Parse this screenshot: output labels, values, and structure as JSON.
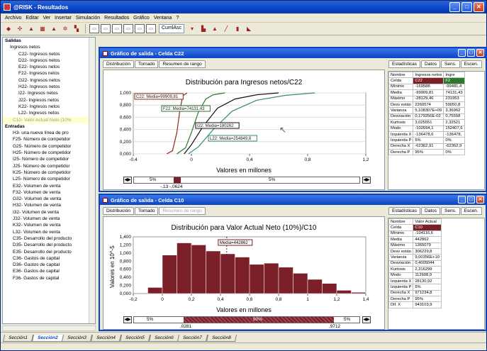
{
  "app": {
    "title": "@RISK - Resultados"
  },
  "menu": [
    "Archivo",
    "Editar",
    "Ver",
    "Insertar",
    "Simulación",
    "Resultados",
    "Gráfico",
    "Ventana",
    "?"
  ],
  "toolbar": {
    "select_value": "CumlAsc"
  },
  "tree": {
    "outputs_header": "Salidas",
    "outputs_group": "Ingresos netos",
    "outputs": [
      "C22- Ingresos netos",
      "D22- Ingresos netos",
      "E22- Ingresos netos",
      "F22- Ingresos netos",
      "G22- Ingresos netos",
      "H22- Ingresos netos",
      "I22- Ingresos netos",
      "J22- Ingresos netos",
      "K22- Ingresos netos",
      "L22- Ingresos netos"
    ],
    "outputs_selected": "C10- Valor Actual Neto (10%",
    "inputs_header": "Entradas",
    "inputs": [
      "H3- una nueva línea de pro",
      "F25- Número de competidor",
      "G25- Número de competidor",
      "H25- Número de competidor",
      "I25- Número de competidor",
      "J25- Número de competidor",
      "K25- Número de competidor",
      "L25- Número de competidor",
      "E32- Volumen de venta",
      "F32- Volumen de venta",
      "G32- Volumen de venta",
      "H32- Volumen de venta",
      "I32- Volumen de venta",
      "J32- Volumen de venta",
      "K32- Volumen de venta",
      "L32- Volumen de venta",
      "C35- Desarrollo del producto",
      "D35- Desarrollo del producto",
      "E35- Desarrollo del producto",
      "C36- Gastos de capital",
      "D36- Gastos de capital",
      "E36- Gastos de capital",
      "F36- Gastos de capital"
    ]
  },
  "win1": {
    "title": "Gráfico de salida - Celda C22",
    "tabs": [
      "Distribución",
      "Tornado",
      "Resumen de rango"
    ],
    "right_tabs": [
      "Estadísticas",
      "Datos",
      "Sens.",
      "Escen."
    ],
    "chart_title": "Distribución para Ingresos netos/C22",
    "xlabel": "Valores en millones",
    "yticks": [
      "1,000",
      "0,800",
      "0,600",
      "0,400",
      "0,200",
      "0,000"
    ],
    "xticks": [
      "-0,4",
      "0",
      "0,4",
      "0,8",
      "1,2"
    ],
    "labels": [
      "C22: Media=99909,81",
      "F22: Media=74131,43",
      "I22: Media=180262",
      "L22: Media=254849,8"
    ],
    "range_left": "5%",
    "range_mid": "90%",
    "range_right": "5%",
    "range_vals": [
      "-,13",
      "-,0624"
    ],
    "stats_header": [
      "Nombre",
      "Ingresos netos",
      "Ingre"
    ],
    "stats_cell": [
      "Celda",
      "C22",
      "F2"
    ],
    "stats_rows": [
      [
        "Mínimo",
        "-169588",
        "-99481,4"
      ],
      [
        "Media",
        "-99909,81",
        "74131,43"
      ],
      [
        "Máximo",
        "-28129,46",
        "231953"
      ],
      [
        "Desv están",
        "2260574",
        "59050,8"
      ],
      [
        "Varianza",
        "5,108307E+09",
        "3,36962"
      ],
      [
        "Desviación",
        "0,179256E-02",
        "0,75558"
      ],
      [
        "Kurtosis",
        "3,025551",
        "2,32521"
      ],
      [
        "Modo",
        "-102694,1",
        "152407,6"
      ],
      [
        "Izquierda X",
        "-136478,6",
        "-136478,"
      ],
      [
        "Izquierda P",
        "5%",
        "0%"
      ],
      [
        "Derecha X",
        "-62362,91",
        "-62362,9"
      ],
      [
        "Derecha P",
        "95%",
        "0%"
      ]
    ]
  },
  "win2": {
    "title": "Gráfico de salida - Celda C10",
    "tabs": [
      "Distribución",
      "Tornado",
      "Resumen de rango"
    ],
    "right_tabs": [
      "Estadísticas",
      "Datos",
      "Sens.",
      "Escen."
    ],
    "chart_title": "Distribución para Valor Actual Neto (10%)/C10",
    "xlabel": "Valores en millones",
    "ylabel": "Valores en",
    "ylabel2": "10^-5",
    "yticks": [
      "1,400",
      "1,200",
      "1,000",
      "0,800",
      "0,600",
      "0,400",
      "0,200",
      "0,000"
    ],
    "xticks": [
      "-0,2",
      "0",
      "0,2",
      "0,4",
      "0,6",
      "0,8",
      "1",
      "1,2",
      "1,4"
    ],
    "mean_label": "Media=442862",
    "range_left": "5%",
    "range_mid": "90%",
    "range_right": "5%",
    "range_vals": [
      ",0281",
      ",9712"
    ],
    "stats_header": [
      "Nombre",
      "Valor Actual"
    ],
    "stats_cell": [
      "Celda",
      "C10"
    ],
    "stats_rows": [
      [
        "Mínimo",
        "-104116,6"
      ],
      [
        "Media",
        "442862"
      ],
      [
        "Máximo",
        "1365079"
      ],
      [
        "Desv están",
        "306229,8"
      ],
      [
        "Varianza",
        "9,00356E+10"
      ],
      [
        "Desviación",
        "0,4005044"
      ],
      [
        "Kurtosis",
        "2,316299"
      ],
      [
        "Modo",
        "112608,9"
      ],
      [
        "Izquierda X",
        "28130,92"
      ],
      [
        "Izquierda P",
        "5%"
      ],
      [
        "Derecha X",
        "971234,8"
      ],
      [
        "Derecha P",
        "95%"
      ],
      [
        "Dif. X",
        "943103,9"
      ]
    ]
  },
  "chart_data": [
    {
      "type": "line",
      "title": "Distribución para Ingresos netos/C22",
      "xlabel": "Valores en millones",
      "ylabel": "",
      "ylim": [
        0,
        1
      ],
      "xlim": [
        -0.4,
        1.2
      ],
      "series": [
        {
          "name": "C22",
          "x": [
            -0.17,
            -0.13,
            -0.1,
            -0.08,
            -0.06,
            -0.03
          ],
          "y": [
            0,
            0.05,
            0.35,
            0.7,
            0.95,
            1
          ]
        },
        {
          "name": "F22",
          "x": [
            -0.1,
            -0.04,
            0.0,
            0.05,
            0.1,
            0.15,
            0.23
          ],
          "y": [
            0,
            0.1,
            0.35,
            0.7,
            0.9,
            0.97,
            1
          ]
        },
        {
          "name": "I22",
          "x": [
            -0.05,
            0.0,
            0.08,
            0.18,
            0.3,
            0.45,
            0.6
          ],
          "y": [
            0,
            0.15,
            0.45,
            0.75,
            0.9,
            0.97,
            1
          ]
        },
        {
          "name": "L22",
          "x": [
            -0.02,
            0.05,
            0.15,
            0.28,
            0.45,
            0.65,
            0.85
          ],
          "y": [
            0,
            0.12,
            0.4,
            0.7,
            0.88,
            0.96,
            1
          ]
        }
      ]
    },
    {
      "type": "bar",
      "title": "Distribución para Valor Actual Neto (10%)/C10",
      "xlabel": "Valores en millones",
      "ylabel": "Valores en 10^-5",
      "ylim": [
        0,
        1.4
      ],
      "x": [
        -0.1,
        0.0,
        0.1,
        0.2,
        0.3,
        0.4,
        0.5,
        0.6,
        0.7,
        0.8,
        0.9,
        1.0,
        1.1,
        1.2,
        1.3
      ],
      "values": [
        0.15,
        0.95,
        1.25,
        1.2,
        1.05,
        0.98,
        0.9,
        0.72,
        0.75,
        0.65,
        0.5,
        0.35,
        0.25,
        0.08,
        0.03
      ]
    }
  ],
  "sheets": [
    "Sección1",
    "Sección2",
    "Sección3",
    "Sección4",
    "Sección5",
    "Sección6",
    "Sección7",
    "Sección8"
  ],
  "colors": {
    "bar": "#7b1f28",
    "accent": "#0a44c4"
  }
}
